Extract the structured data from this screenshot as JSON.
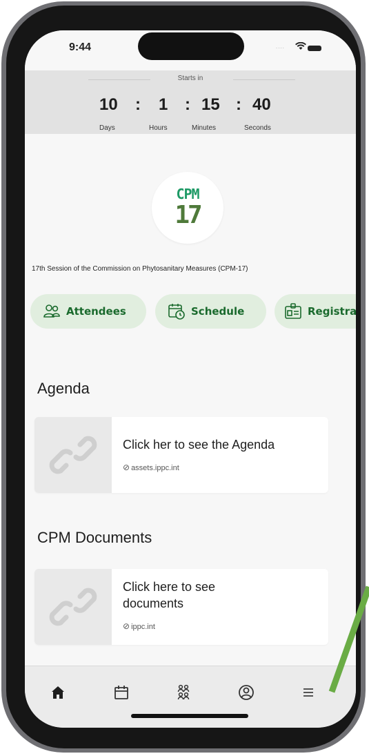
{
  "status_bar": {
    "time": "9:44",
    "signal": "....",
    "wifi": "wifi-icon",
    "battery": "battery-icon"
  },
  "countdown": {
    "label": "Starts in",
    "days": "10",
    "hours": "1",
    "minutes": "15",
    "seconds": "40",
    "separator": ":",
    "days_label": "Days",
    "hours_label": "Hours",
    "minutes_label": "Minutes",
    "seconds_label": "Seconds"
  },
  "logo": {
    "top": "CPM",
    "bottom": "17"
  },
  "session_title": "17th Session of the Commission on Phytosanitary Measures (CPM-17)",
  "pills": [
    {
      "label": "Attendees",
      "icon": "people-icon"
    },
    {
      "label": "Schedule",
      "icon": "calendar-clock-icon"
    },
    {
      "label": "Registra",
      "icon": "id-card-icon"
    }
  ],
  "agenda": {
    "heading": "Agenda",
    "card": {
      "title": "Click her to see the Agenda",
      "source": "assets.ippc.int",
      "icon": "link-icon"
    }
  },
  "documents": {
    "heading": "CPM Documents",
    "card": {
      "title": "Click here to see documents",
      "source": "ippc.int",
      "icon": "link-icon"
    }
  },
  "bottom_nav": [
    {
      "name": "home",
      "icon": "home-icon"
    },
    {
      "name": "calendar",
      "icon": "calendar-icon"
    },
    {
      "name": "people",
      "icon": "people-grid-icon"
    },
    {
      "name": "profile",
      "icon": "profile-icon"
    },
    {
      "name": "menu",
      "icon": "menu-icon"
    }
  ],
  "colors": {
    "pill_bg": "#e1eedf",
    "pill_text": "#1a6a2d",
    "logo_green": "#1e9a66",
    "logo_olive": "#4f7a3a",
    "annotation_arrow": "#6aac45"
  }
}
